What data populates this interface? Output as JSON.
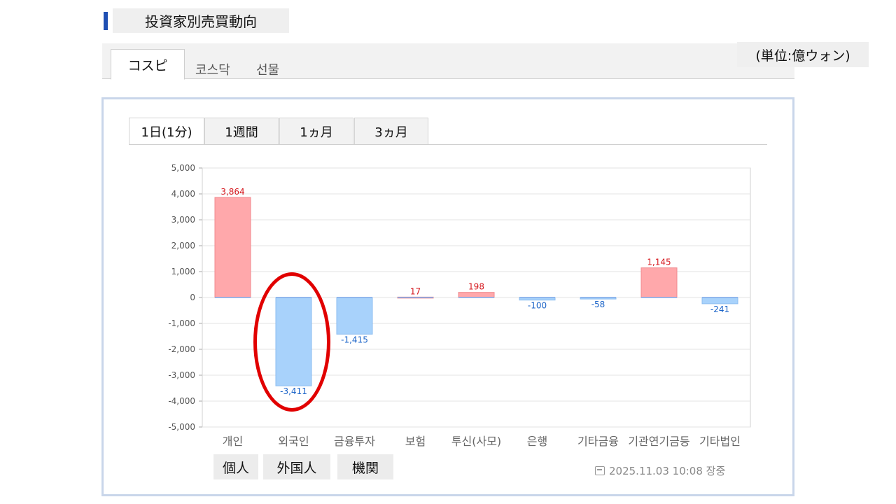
{
  "header": {
    "title": "投資家別売買動向",
    "unit": "(単位:億ウォン)"
  },
  "market_tabs": [
    {
      "label": "コスピ",
      "active": true
    },
    {
      "label": "코스닥",
      "active": false
    },
    {
      "label": "선물",
      "active": false
    }
  ],
  "period_tabs": [
    {
      "label": "1日(1分)",
      "active": true
    },
    {
      "label": "1週間",
      "active": false
    },
    {
      "label": "1ヵ月",
      "active": false
    },
    {
      "label": "3ヵ月",
      "active": false
    }
  ],
  "annotations": [
    "個人",
    "外国人",
    "機関"
  ],
  "timestamp": "2025.11.03 10:08 장중",
  "colors": {
    "positive_fill": "#ffa8ab",
    "positive_text": "#d6191f",
    "negative_fill": "#a8d2fb",
    "negative_text": "#1a63c8",
    "highlight": "#e10000"
  },
  "chart_data": {
    "type": "bar",
    "categories": [
      "개인",
      "외국인",
      "금융투자",
      "보험",
      "투신(사모)",
      "은행",
      "기타금융",
      "기관연기금등",
      "기타법인"
    ],
    "values": [
      3864,
      -3411,
      -1415,
      17,
      198,
      -100,
      -58,
      1145,
      -241
    ],
    "value_labels": [
      "3,864",
      "-3,411",
      "-1,415",
      "17",
      "198",
      "-100",
      "-58",
      "1,145",
      "-241"
    ],
    "y_ticks": [
      "5,000",
      "4,000",
      "3,000",
      "2,000",
      "1,000",
      "0",
      "-1,000",
      "-2,000",
      "-3,000",
      "-4,000",
      "-5,000"
    ],
    "ylim": [
      -5000,
      5000
    ],
    "grid": true,
    "xlabel": "",
    "ylabel": ""
  }
}
